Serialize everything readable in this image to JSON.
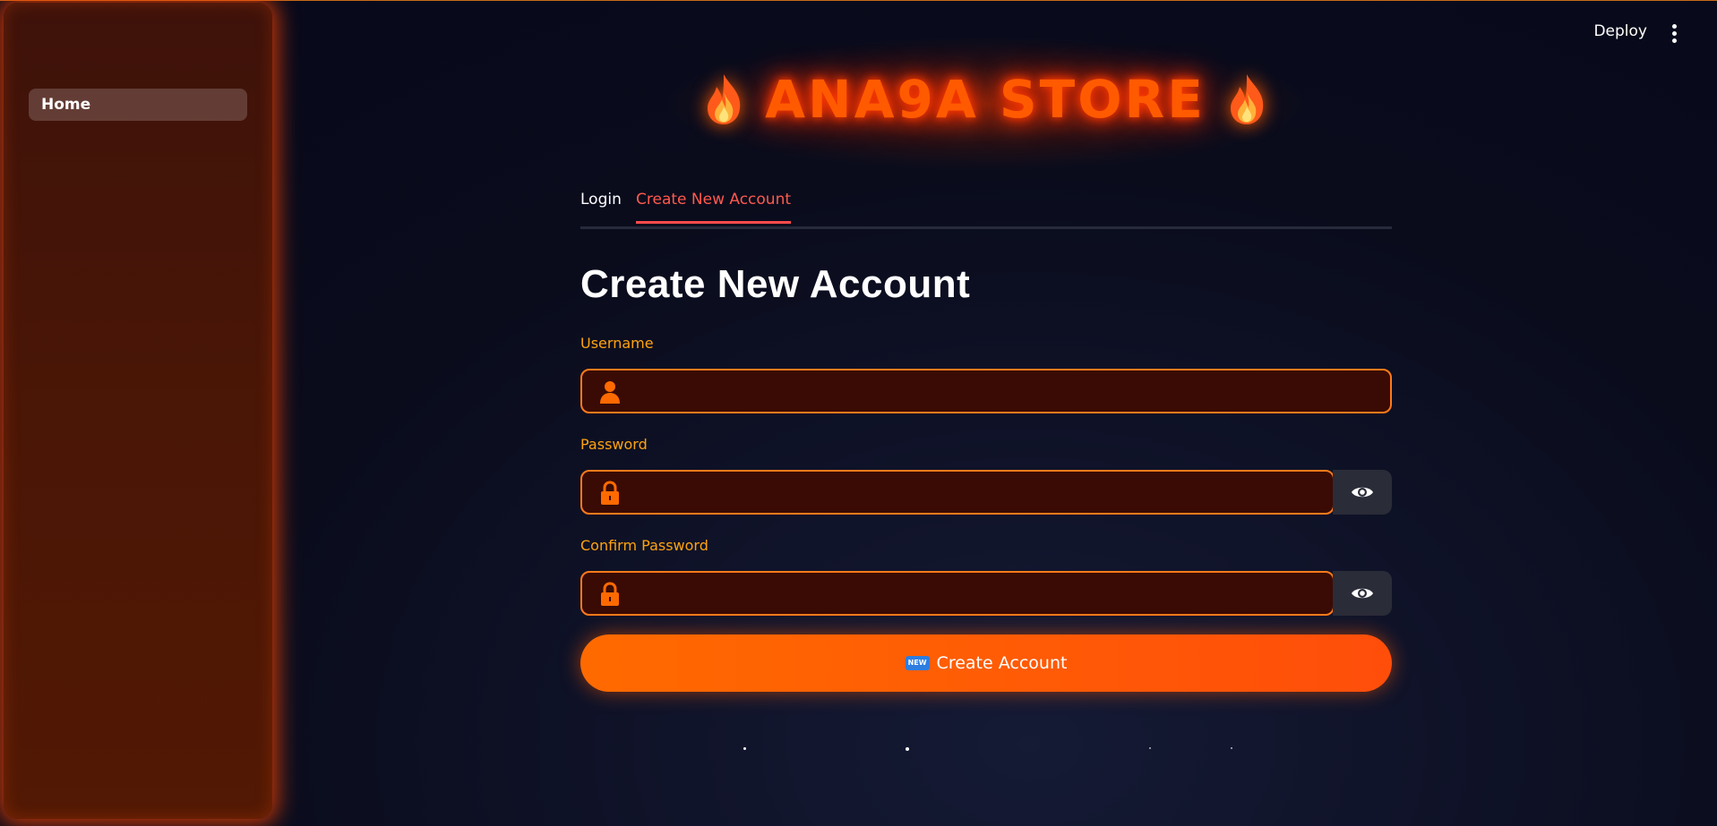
{
  "sidebar": {
    "items": [
      {
        "label": "Home"
      }
    ]
  },
  "toolbar": {
    "deploy_label": "Deploy",
    "menu_icon": "kebab-menu-icon"
  },
  "header": {
    "title": "ANA9A STORE",
    "flame_icon": "fire-icon"
  },
  "tabs": [
    {
      "label": "Login",
      "active": false
    },
    {
      "label": "Create New Account",
      "active": true
    }
  ],
  "form": {
    "title": "Create New Account",
    "username": {
      "label": "Username",
      "value": "",
      "placeholder": "",
      "icon": "user-icon"
    },
    "password": {
      "label": "Password",
      "value": "",
      "placeholder": "",
      "icon": "lock-icon"
    },
    "confirm_password": {
      "label": "Confirm Password",
      "value": "",
      "placeholder": "",
      "icon": "lock-icon"
    },
    "submit": {
      "label": "Create Account",
      "badge": "NEW"
    }
  },
  "colors": {
    "accent": "#ff5a00",
    "label": "#ffa30f",
    "tab_active": "#ff4b4b",
    "sidebar": "#4a1606",
    "background": "#0b0d1c"
  }
}
